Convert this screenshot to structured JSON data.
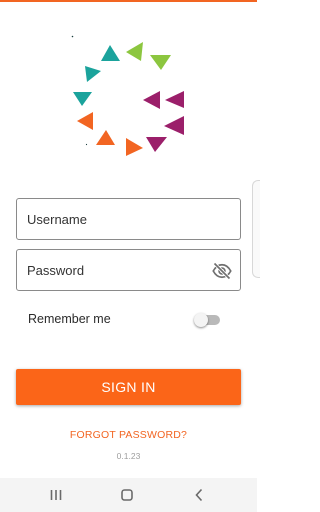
{
  "login": {
    "username_placeholder": "Username",
    "password_placeholder": "Password",
    "remember_label": "Remember me",
    "remember_checked": false,
    "signin_label": "SIGN IN",
    "forgot_label": "FORGOT PASSWORD?",
    "version": "0.1.23"
  },
  "icons": {
    "logo": "triangle-ring-logo",
    "password_visibility": "eye-off-icon",
    "nav_recents": "recents-icon",
    "nav_home": "home-icon",
    "nav_back": "back-icon"
  },
  "colors": {
    "accent": "#f26522",
    "button": "#fb6518",
    "logo_teal": "#1ba39c",
    "logo_green": "#8cc63f",
    "logo_purple": "#9b1f6a",
    "logo_orange": "#f26522"
  }
}
